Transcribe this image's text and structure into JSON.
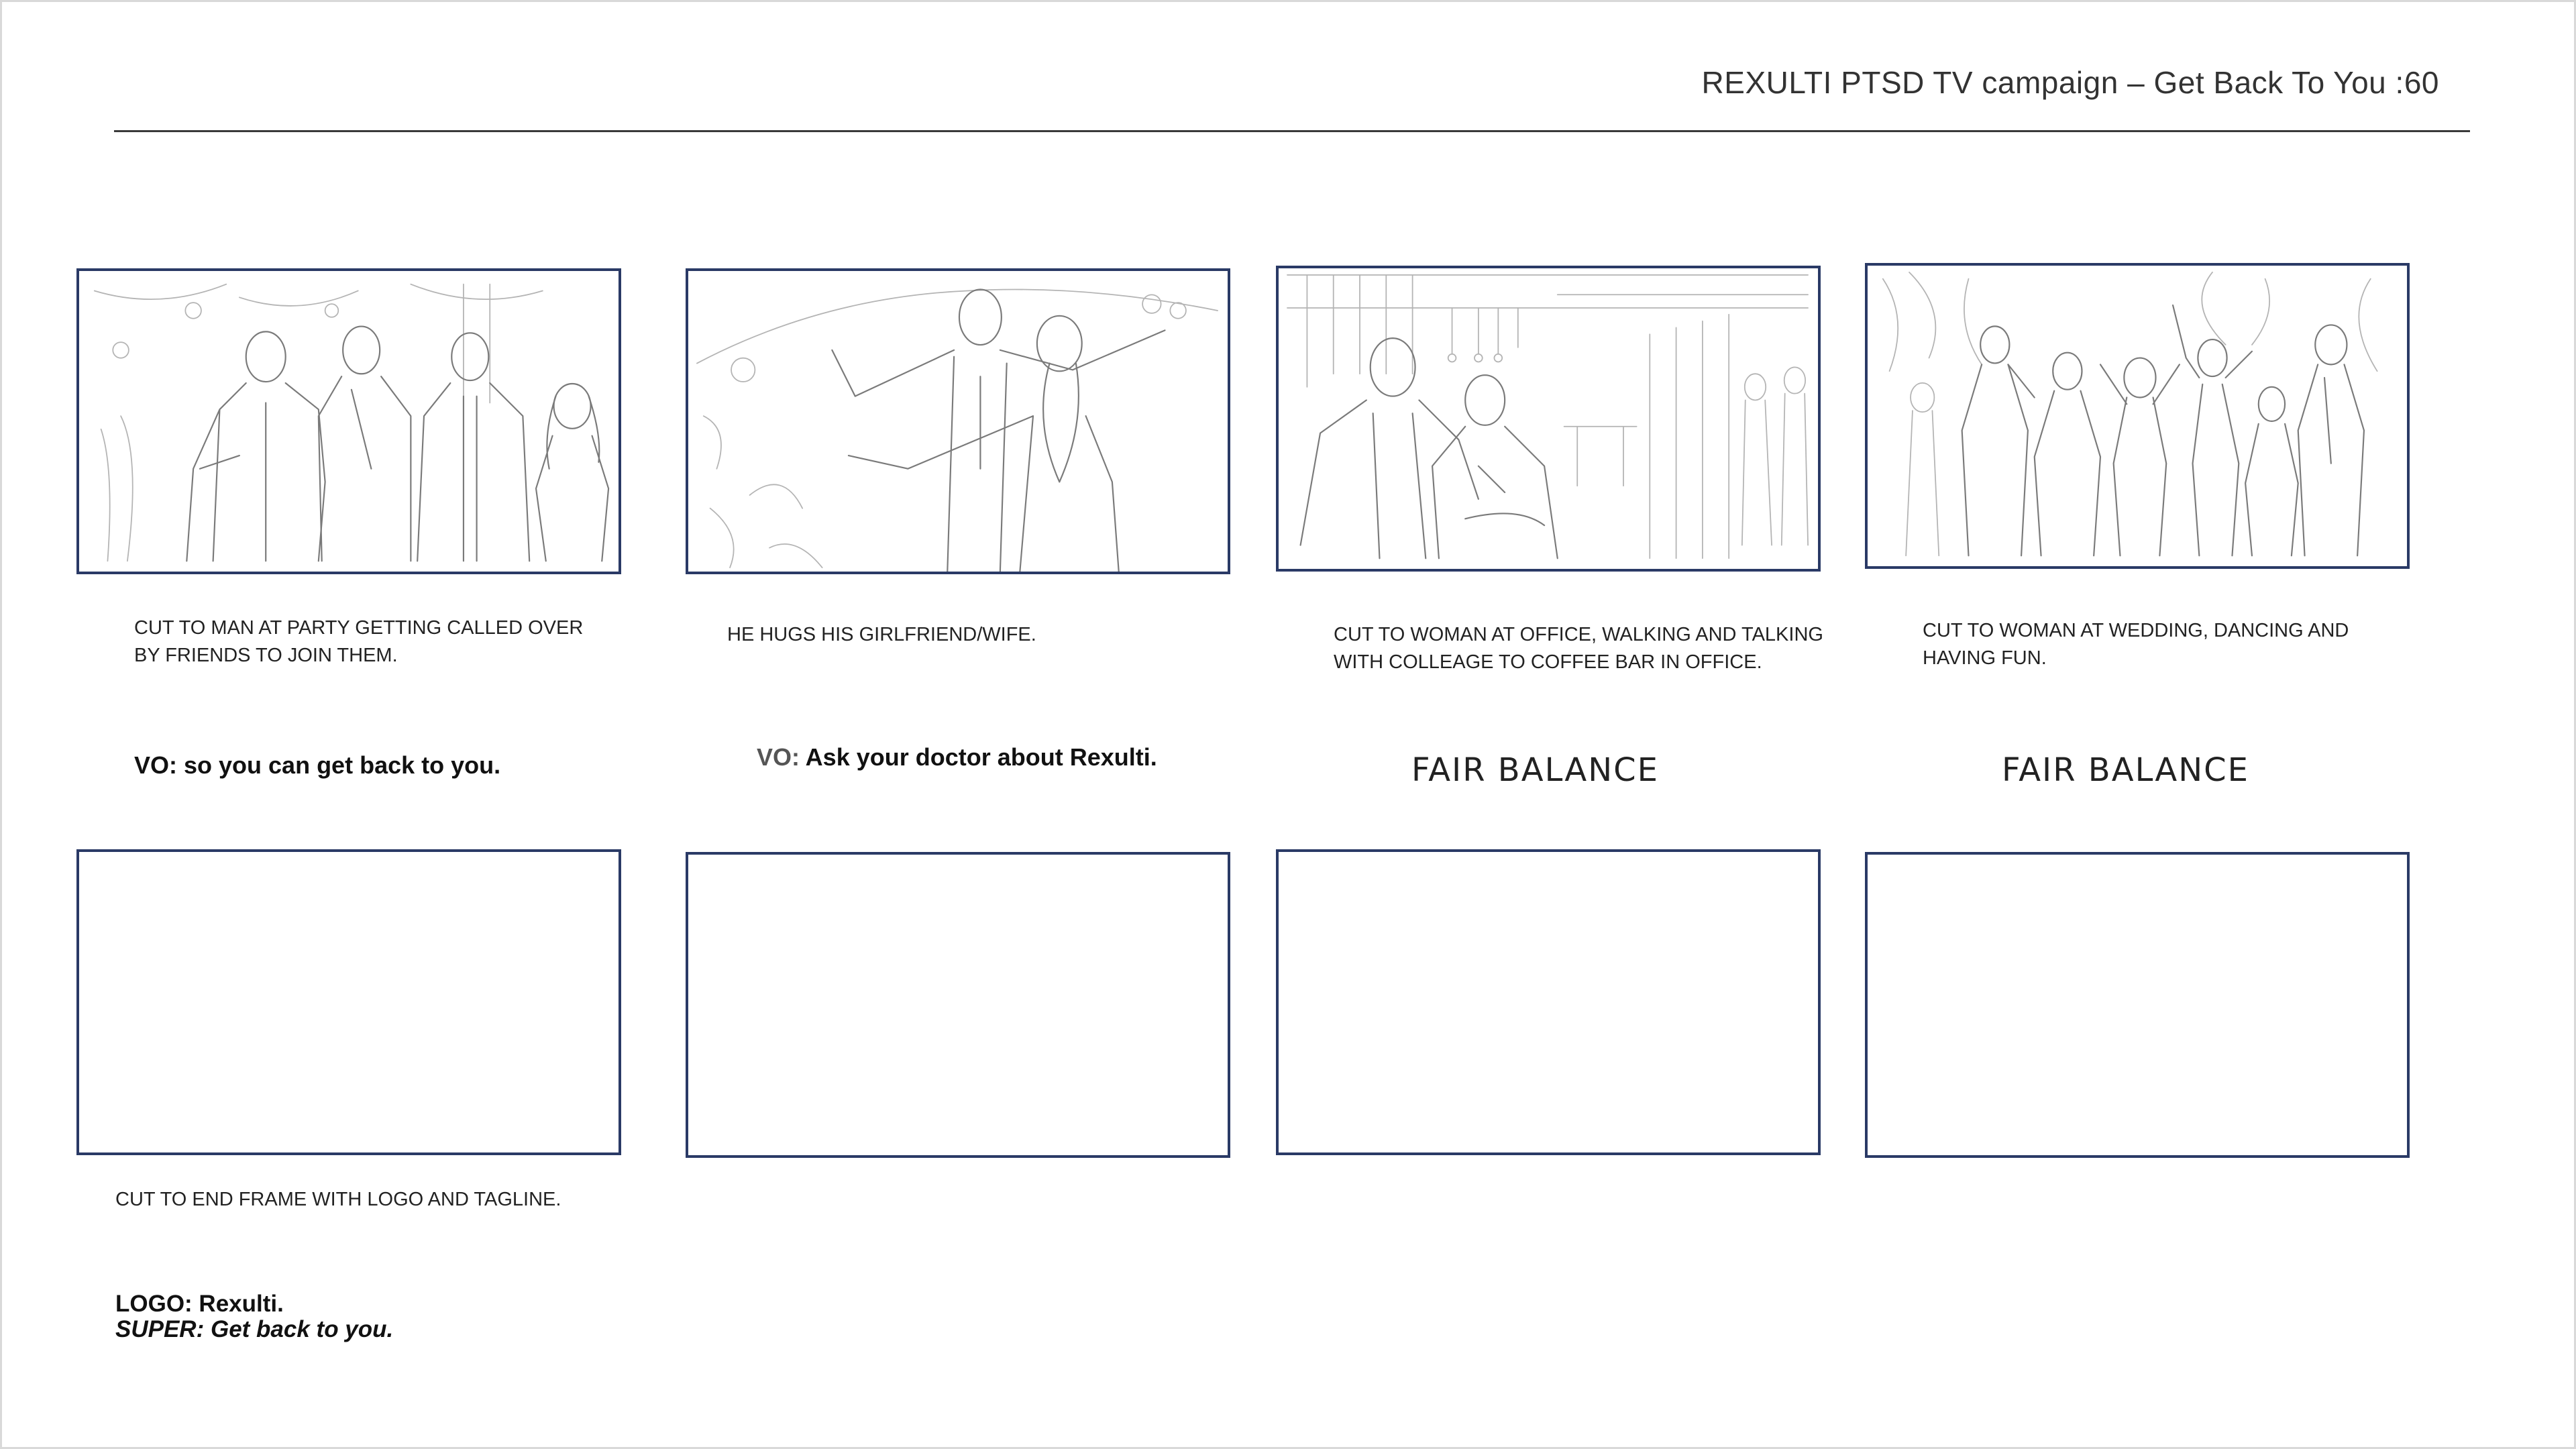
{
  "header": {
    "title": "REXULTI PTSD TV campaign – Get Back To You :60"
  },
  "panels": [
    {
      "description": "CUT TO MAN AT PARTY GETTING CALLED OVER\nBY FRIENDS TO JOIN THEM.",
      "vo_label": "VO:",
      "vo_text": " so you can get back to you."
    },
    {
      "description": "HE HUGS HIS GIRLFRIEND/WIFE.",
      "vo_label": "VO:",
      "vo_text": " Ask your doctor about Rexulti."
    },
    {
      "description": "CUT TO WOMAN AT OFFICE, WALKING AND TALKING\nWITH COLLEAGE TO COFFEE BAR IN OFFICE.",
      "fair_balance": "FAIR BALANCE"
    },
    {
      "description": "CUT TO WOMAN AT WEDDING, DANCING AND\nHAVING FUN.",
      "fair_balance": "FAIR BALANCE"
    }
  ],
  "end_frame": {
    "description": "CUT TO END FRAME WITH LOGO AND TAGLINE.",
    "logo_line": "LOGO: Rexulti.",
    "super_line": "SUPER: Get back to you."
  },
  "colors": {
    "frame_border": "#2a3a66",
    "rule": "#3a3a3a"
  }
}
